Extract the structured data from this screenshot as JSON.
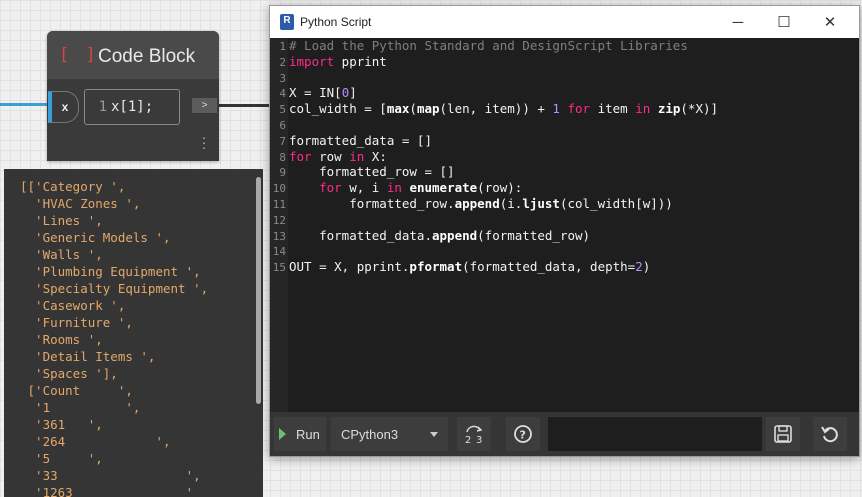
{
  "node": {
    "icon": "[ ]",
    "title": "Code Block",
    "input_port": "x",
    "line_number": "1",
    "code": "x[1];",
    "output_port": ">",
    "menu_icon": "more-vertical-icon"
  },
  "preview": {
    "lines": [
      "[['Category ',",
      "  'HVAC Zones ',",
      "  'Lines ',",
      "  'Generic Models ',",
      "  'Walls ',",
      "  'Plumbing Equipment ',",
      "  'Specialty Equipment ',",
      "  'Casework ',",
      "  'Furniture ',",
      "  'Rooms ',",
      "  'Detail Items ',",
      "  'Spaces '],",
      " ['Count     ',",
      "  '1          ',",
      "  '361   ',",
      "  '264            ',",
      "  '5     ',",
      "  '33                 ',",
      "  '1263               '"
    ]
  },
  "window": {
    "app_icon": "R",
    "title": "Python Script",
    "minimize": "─",
    "maximize": "☐",
    "close": "✕"
  },
  "code_lines": [
    {
      "n": "1",
      "html": "<span class=\"cm\"># Load the Python Standard and DesignScript Libraries</span>"
    },
    {
      "n": "2",
      "html": "<span class=\"kw\">import</span> pprint"
    },
    {
      "n": "3",
      "html": ""
    },
    {
      "n": "4",
      "html": "X = IN[<span class=\"nm\">0</span>]"
    },
    {
      "n": "5",
      "html": "col_width = [<span class=\"fn\">max</span>(<span class=\"fn\">map</span>(len, item)) + <span class=\"nm\">1</span> <span class=\"kw\">for</span> item <span class=\"kw\">in</span> <span class=\"fn\">zip</span>(*X)]"
    },
    {
      "n": "6",
      "html": ""
    },
    {
      "n": "7",
      "html": "formatted_data = []"
    },
    {
      "n": "8",
      "html": "<span class=\"kw\">for</span> row <span class=\"kw\">in</span> X:"
    },
    {
      "n": "9",
      "html": "    formatted_row = []"
    },
    {
      "n": "10",
      "html": "    <span class=\"kw\">for</span> w, i <span class=\"kw\">in</span> <span class=\"fn\">enumerate</span>(row):"
    },
    {
      "n": "11",
      "html": "        formatted_row.<span class=\"fn\">append</span>(i.<span class=\"fn\">ljust</span>(col_width[w]))"
    },
    {
      "n": "12",
      "html": ""
    },
    {
      "n": "13",
      "html": "    formatted_data.<span class=\"fn\">append</span>(formatted_row)"
    },
    {
      "n": "14",
      "html": ""
    },
    {
      "n": "15",
      "html": "OUT = X, pprint.<span class=\"fn\">pformat</span>(formatted_data, depth=<span class=\"nm\">2</span>)"
    }
  ],
  "toolbar": {
    "run_label": "Run",
    "engine": "CPython3",
    "migrate_icon": "migrate-icon",
    "help_icon": "help-icon",
    "save_icon": "save-icon",
    "revert_icon": "revert-icon"
  },
  "colors": {
    "keyword": "#ff2a8a",
    "comment": "#7f7f7f",
    "number": "#b98cff",
    "preview_text": "#e3a86a",
    "wire_input": "#3aa0d8"
  }
}
